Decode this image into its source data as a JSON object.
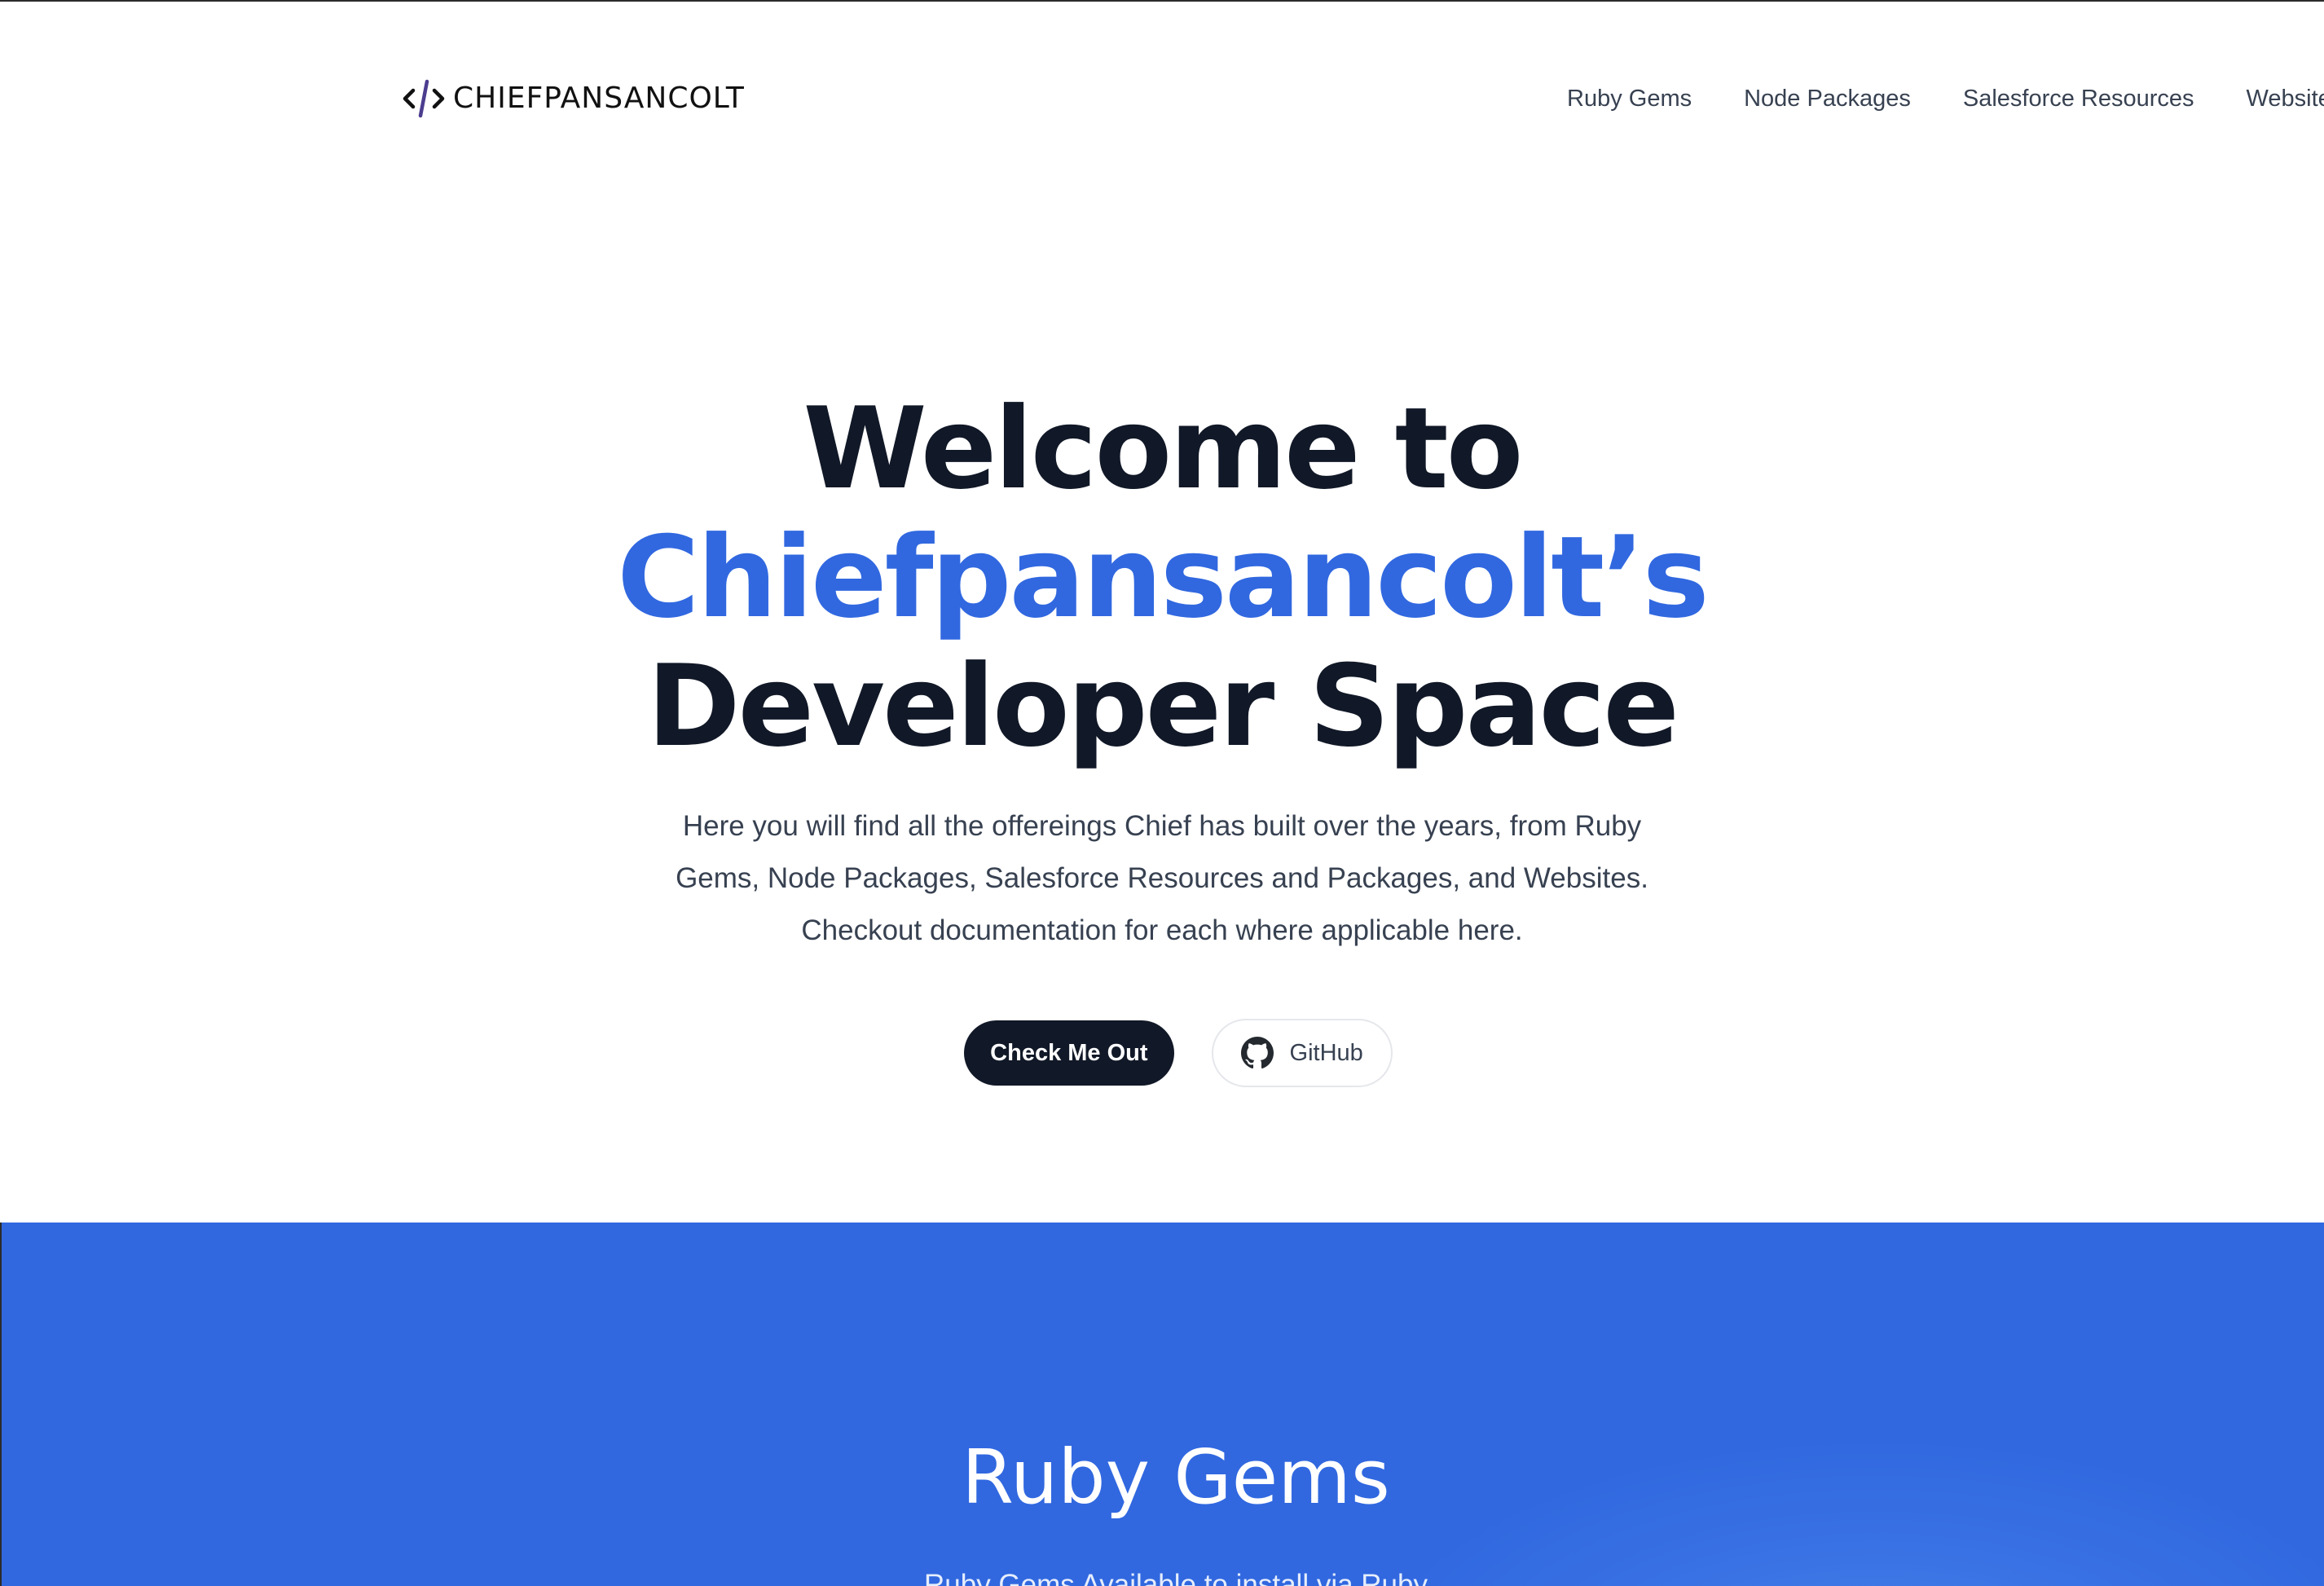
{
  "brand": {
    "name": "CHIEFPANSANCOLT",
    "icon": "code-brackets-icon"
  },
  "nav": {
    "items": [
      {
        "label": "Ruby Gems"
      },
      {
        "label": "Node Packages"
      },
      {
        "label": "Salesforce Resources"
      },
      {
        "label": "Websites"
      }
    ]
  },
  "hero": {
    "title_line1": "Welcome to",
    "title_line2": "Chiefpansancolt’s",
    "title_line3": "Developer Space",
    "description": "Here you will find all the offereings Chief has built over the years, from Ruby Gems, Node Packages, Salesforce Resources and Packages, and Websites. Checkout documentation for each where applicable here.",
    "primary_button": "Check Me Out",
    "secondary_button": "GitHub",
    "secondary_icon": "github-icon"
  },
  "ruby_gems": {
    "title": "Ruby Gems",
    "description": "Ruby Gems Available to install via Ruby"
  },
  "colors": {
    "accent": "#3168e0",
    "dark": "#111827",
    "text": "#374151"
  }
}
